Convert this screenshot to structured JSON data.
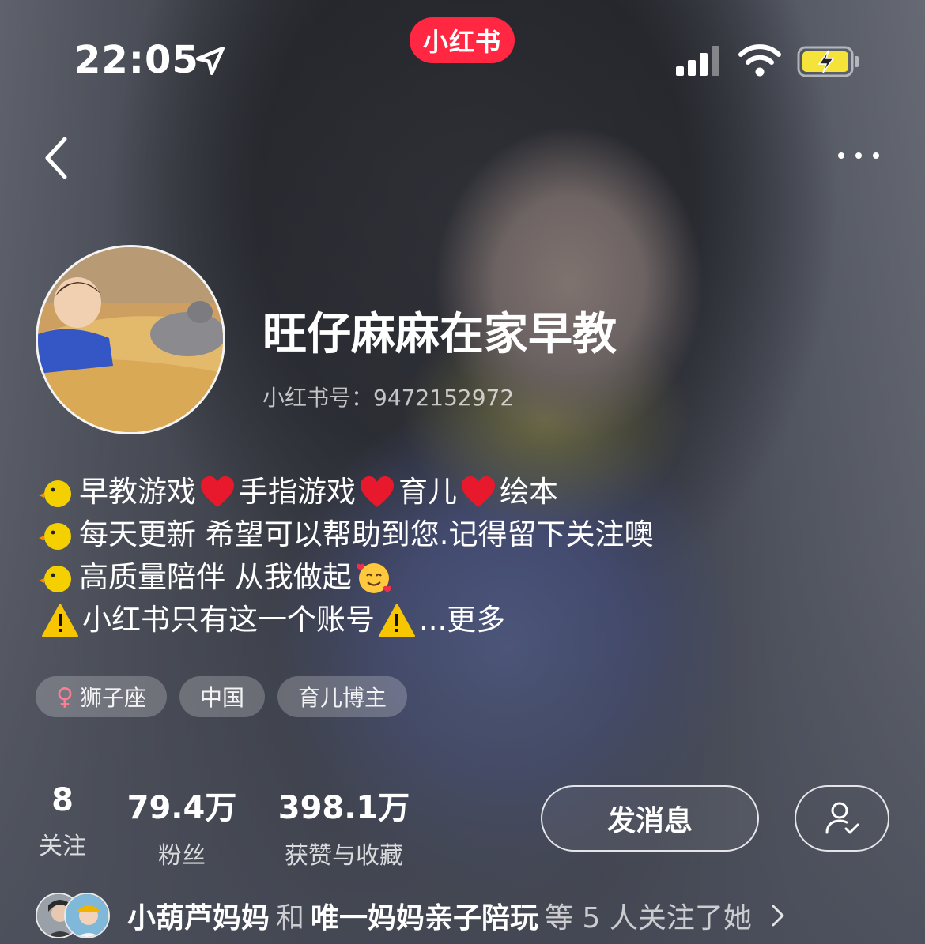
{
  "status_bar": {
    "time": "22:05",
    "app_badge": "小红书"
  },
  "profile": {
    "name": "旺仔麻麻在家早教",
    "account_id": "小红书号：9472152972",
    "bio": {
      "line1": {
        "a": "早教游戏",
        "b": "手指游戏",
        "c": "育儿",
        "d": "绘本"
      },
      "line2": "每天更新 希望可以帮助到您.记得留下关注噢",
      "line3": "高质量陪伴 从我做起",
      "line4": {
        "a": "小红书只有这一个账号",
        "more": "...更多"
      }
    },
    "tags": {
      "zodiac": "狮子座",
      "location": "中国",
      "role": "育儿博主"
    },
    "stats": {
      "following": {
        "value": "8",
        "label": "关注"
      },
      "fans": {
        "value": "79.4万",
        "label": "粉丝"
      },
      "likes": {
        "value": "398.1万",
        "label": "获赞与收藏"
      }
    },
    "actions": {
      "message": "发消息"
    },
    "mutual": {
      "user1": "小葫芦妈妈",
      "and": "和",
      "user2": "唯一妈妈亲子陪玩",
      "suffix": "等 5 人关注了她"
    }
  },
  "colors": {
    "brand": "#ff2741",
    "female": "#ff7c97",
    "battery": "#f6e33a"
  }
}
